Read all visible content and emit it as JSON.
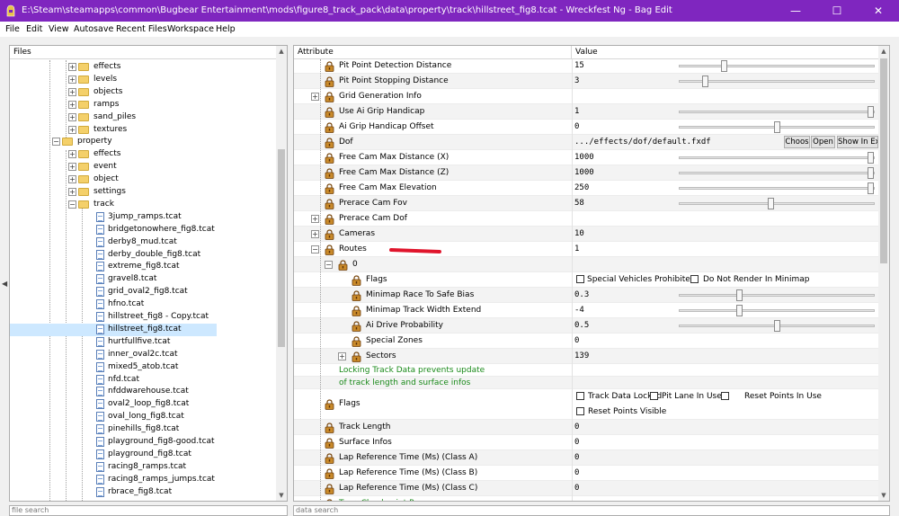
{
  "window": {
    "title": "E:\\Steam\\steamapps\\common\\Bugbear Entertainment\\mods\\figure8_track_pack\\data\\property\\track\\hillstreet_fig8.tcat - Wreckfest Ng - Bag Edit",
    "minimize_glyph": "—",
    "maximize_glyph": "☐",
    "close_glyph": "✕"
  },
  "menu": [
    "File",
    "Edit",
    "View",
    "Autosave",
    "Recent Files",
    "Workspace",
    "Help"
  ],
  "files_panel": {
    "header": "Files",
    "search_placeholder": "file search",
    "tree": [
      {
        "label": "effects",
        "type": "folder",
        "depth": 1,
        "expand": "+"
      },
      {
        "label": "levels",
        "type": "folder",
        "depth": 1,
        "expand": "+"
      },
      {
        "label": "objects",
        "type": "folder",
        "depth": 1,
        "expand": "+"
      },
      {
        "label": "ramps",
        "type": "folder",
        "depth": 1,
        "expand": "+"
      },
      {
        "label": "sand_piles",
        "type": "folder",
        "depth": 1,
        "expand": "+"
      },
      {
        "label": "textures",
        "type": "folder",
        "depth": 1,
        "expand": "+"
      },
      {
        "label": "property",
        "type": "folder",
        "depth": 0,
        "expand": "−"
      },
      {
        "label": "effects",
        "type": "folder",
        "depth": 1,
        "expand": "+"
      },
      {
        "label": "event",
        "type": "folder",
        "depth": 1,
        "expand": "+"
      },
      {
        "label": "object",
        "type": "folder",
        "depth": 1,
        "expand": "+"
      },
      {
        "label": "settings",
        "type": "folder",
        "depth": 1,
        "expand": "+"
      },
      {
        "label": "track",
        "type": "folder",
        "depth": 1,
        "expand": "−"
      },
      {
        "label": "3jump_ramps.tcat",
        "type": "file",
        "depth": 2
      },
      {
        "label": "bridgetonowhere_fig8.tcat",
        "type": "file",
        "depth": 2
      },
      {
        "label": "derby8_mud.tcat",
        "type": "file",
        "depth": 2
      },
      {
        "label": "derby_double_fig8.tcat",
        "type": "file",
        "depth": 2
      },
      {
        "label": "extreme_fig8.tcat",
        "type": "file",
        "depth": 2
      },
      {
        "label": "gravel8.tcat",
        "type": "file",
        "depth": 2
      },
      {
        "label": "grid_oval2_fig8.tcat",
        "type": "file",
        "depth": 2
      },
      {
        "label": "hfno.tcat",
        "type": "file",
        "depth": 2
      },
      {
        "label": "hillstreet_fig8 - Copy.tcat",
        "type": "file",
        "depth": 2
      },
      {
        "label": "hillstreet_fig8.tcat",
        "type": "file",
        "depth": 2,
        "selected": true
      },
      {
        "label": "hurtfullfive.tcat",
        "type": "file",
        "depth": 2
      },
      {
        "label": "inner_oval2c.tcat",
        "type": "file",
        "depth": 2
      },
      {
        "label": "mixed5_atob.tcat",
        "type": "file",
        "depth": 2
      },
      {
        "label": "nfd.tcat",
        "type": "file",
        "depth": 2
      },
      {
        "label": "nfddwarehouse.tcat",
        "type": "file",
        "depth": 2
      },
      {
        "label": "oval2_loop_fig8.tcat",
        "type": "file",
        "depth": 2
      },
      {
        "label": "oval_long_fig8.tcat",
        "type": "file",
        "depth": 2
      },
      {
        "label": "pinehills_fig8.tcat",
        "type": "file",
        "depth": 2
      },
      {
        "label": "playground_fig8-good.tcat",
        "type": "file",
        "depth": 2
      },
      {
        "label": "playground_fig8.tcat",
        "type": "file",
        "depth": 2
      },
      {
        "label": "racing8_ramps.tcat",
        "type": "file",
        "depth": 2
      },
      {
        "label": "racing8_ramps_jumps.tcat",
        "type": "file",
        "depth": 2
      },
      {
        "label": "rbrace_fig8.tcat",
        "type": "file",
        "depth": 2
      }
    ]
  },
  "attr_panel": {
    "header_attribute": "Attribute",
    "header_value": "Value",
    "search_placeholder": "data search",
    "rows": [
      {
        "name": "Pit Point Detection Distance",
        "value": "15",
        "slider": 0.22,
        "h": 17
      },
      {
        "name": "Pit Point Stopping Distance",
        "value": "3",
        "slider": 0.12,
        "h": 17
      },
      {
        "name": "Grid Generation Info",
        "value": "",
        "expand": "+",
        "h": 17
      },
      {
        "name": "Use Ai Grip Handicap",
        "value": "1",
        "slider": 1.0,
        "h": 17
      },
      {
        "name": "Ai Grip Handicap Offset",
        "value": "0",
        "slider": 0.5,
        "h": 17
      },
      {
        "name": "Dof",
        "value": ".../effects/dof/default.fxdf",
        "buttons": [
          "Choos",
          "Open",
          "Show In Ex"
        ],
        "h": 17
      },
      {
        "name": "Free Cam Max Distance (X)",
        "value": "1000",
        "slider": 1.0,
        "h": 17
      },
      {
        "name": "Free Cam Max Distance (Z)",
        "value": "1000",
        "slider": 1.0,
        "h": 17
      },
      {
        "name": "Free Cam Max Elevation",
        "value": "250",
        "slider": 1.0,
        "h": 17
      },
      {
        "name": "Prerace Cam Fov",
        "value": "58",
        "slider": 0.47,
        "h": 17
      },
      {
        "name": "Prerace Cam Dof",
        "value": "",
        "expand": "+",
        "h": 17
      },
      {
        "name": "Cameras",
        "value": "10",
        "expand": "+",
        "h": 17
      },
      {
        "name": "Routes",
        "value": "1",
        "expand": "−",
        "h": 17,
        "redmark": true
      },
      {
        "name": "0",
        "value": "",
        "expand": "−",
        "indent": 1,
        "h": 17
      },
      {
        "name": "Flags",
        "value": "",
        "indent": 2,
        "h": 17,
        "checks": [
          "Special Vehicles Prohibited",
          "Do Not Render In Minimap"
        ]
      },
      {
        "name": "Minimap Race To Safe Bias",
        "value": "0.3",
        "indent": 2,
        "slider": 0.3,
        "h": 17
      },
      {
        "name": "Minimap Track Width Extend",
        "value": "-4",
        "indent": 2,
        "slider": 0.3,
        "h": 17
      },
      {
        "name": "Ai Drive Probability",
        "value": "0.5",
        "indent": 2,
        "slider": 0.5,
        "h": 17
      },
      {
        "name": "Special Zones",
        "value": "0",
        "indent": 2,
        "h": 17
      },
      {
        "name": "Sectors",
        "value": "139",
        "indent": 2,
        "expand": "+",
        "h": 17
      },
      {
        "name": "Locking Track Data prevents update",
        "value": "",
        "green": true,
        "h": 14
      },
      {
        "name": "of track length and surface infos",
        "value": "",
        "green": true,
        "h": 14
      },
      {
        "name": "Flags",
        "value": "",
        "h": 34,
        "checks2": [
          [
            "Track Data Locked",
            "Pit Lane In Use",
            "Reset Points In Use"
          ],
          [
            "Reset Points Visible"
          ]
        ]
      },
      {
        "name": "Track Length",
        "value": "0",
        "h": 17
      },
      {
        "name": "Surface Infos",
        "value": "0",
        "h": 17
      },
      {
        "name": "Lap Reference Time (Ms) (Class A)",
        "value": "0",
        "h": 17
      },
      {
        "name": "Lap Reference Time (Ms) (Class B)",
        "value": "0",
        "h": 17
      },
      {
        "name": "Lap Reference Time (Ms) (Class C)",
        "value": "0",
        "h": 17
      },
      {
        "name": "Tour: Checkpoint Race",
        "value": "",
        "green": true,
        "h": 17
      }
    ]
  },
  "colors": {
    "titlebar": "#7f26bf",
    "green_text": "#1a8a1a",
    "selection": "#cde8ff",
    "annotation_red": "#e0152c"
  }
}
